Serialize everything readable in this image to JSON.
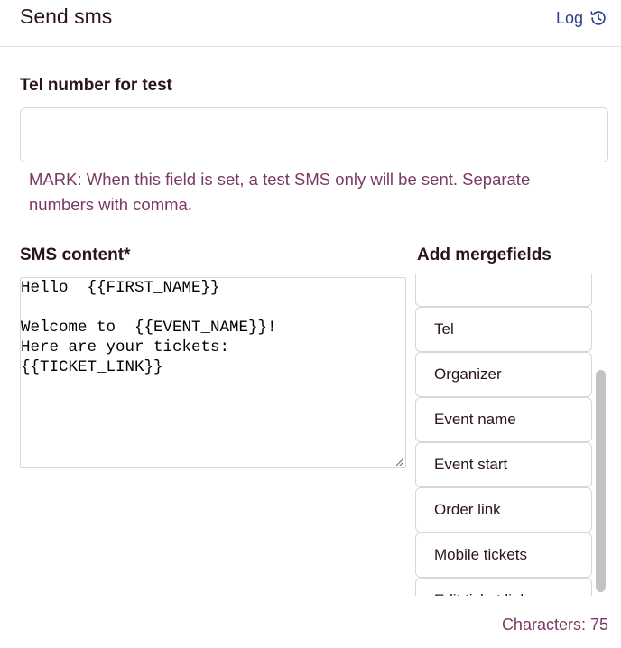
{
  "header": {
    "title": "Send sms",
    "log_label": "Log",
    "log_icon": "history-icon",
    "accent_color": "#2c3e8c"
  },
  "tel": {
    "label": "Tel number for test",
    "value": "",
    "hint": "MARK: When this field is set, a test SMS only will be sent. Separate numbers with comma."
  },
  "sms": {
    "label": "SMS content*",
    "content": "Hello  {{FIRST_NAME}}\n\nWelcome to  {{EVENT_NAME}}!\nHere are your tickets:\n{{TICKET_LINK}}"
  },
  "mergefields": {
    "label": "Add mergefields",
    "items": [
      {
        "label": ""
      },
      {
        "label": "Tel"
      },
      {
        "label": "Organizer"
      },
      {
        "label": "Event name"
      },
      {
        "label": "Event start"
      },
      {
        "label": "Order link"
      },
      {
        "label": "Mobile tickets"
      },
      {
        "label": "Edit ticket link"
      }
    ]
  },
  "footer": {
    "characters_label": "Characters: 75"
  },
  "colors": {
    "hint_text": "#7a3a62",
    "heading_text": "#2a1420"
  }
}
